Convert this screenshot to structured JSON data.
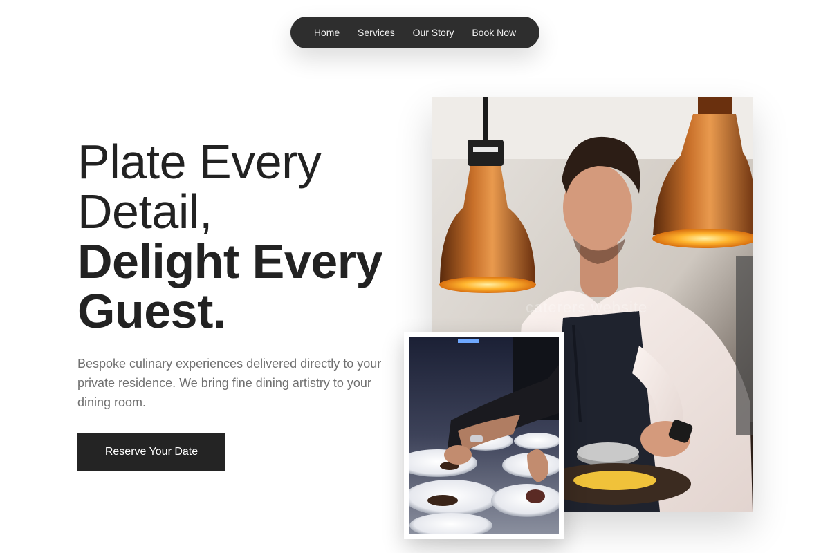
{
  "nav": {
    "items": [
      {
        "label": "Home"
      },
      {
        "label": "Services"
      },
      {
        "label": "Our Story"
      },
      {
        "label": "Book Now"
      }
    ]
  },
  "hero": {
    "headline_line1": "Plate Every",
    "headline_line2": "Detail,",
    "headline_line3": "Delight Every",
    "headline_line4": "Guest.",
    "subtitle": "Bespoke culinary experiences delivered directly to your private residence. We bring fine dining artistry to your dining room.",
    "cta_label": "Reserve Your Date"
  },
  "images": {
    "main_alt": "Chef plating food under copper heat lamps",
    "small_alt": "Hands plating dishes on white plates",
    "watermark": "caterers.website"
  },
  "colors": {
    "nav_bg": "#2e2e2e",
    "cta_bg": "#242424",
    "headline": "#222222",
    "subtitle": "#707070",
    "copper": "#b5651d"
  }
}
